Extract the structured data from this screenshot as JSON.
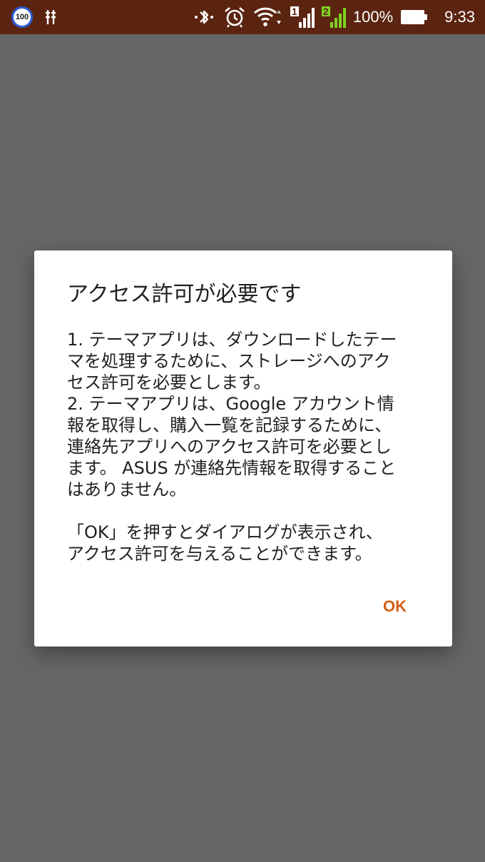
{
  "status_bar": {
    "badge": "100",
    "sim1": "1",
    "sim2": "2",
    "battery": "100%",
    "time": "9:33",
    "icons": [
      "bluetooth-icon",
      "alarm-icon",
      "wifi-icon",
      "signal-sim1-icon",
      "signal-sim2-icon",
      "battery-icon"
    ]
  },
  "dialog": {
    "title": "アクセス許可が必要です",
    "paragraph1": "1. テーマアプリは、ダウンロードしたテー\nマを処理するために、ストレージへのアク\nセス許可を必要とします。\n2. テーマアプリは、Google アカウント情\n報を取得し、購入一覧を記録するために、\n連絡先アプリへのアクセス許可を必要とし\nます。 ASUS が連絡先情報を取得すること\nはありません。",
    "paragraph2": "「OK」を押すとダイアログが表示され、\nアクセス許可を与えることができます。",
    "ok_label": "OK"
  },
  "colors": {
    "status_bar": "#5b2410",
    "scrim": "#666666",
    "accent": "#d55e13"
  }
}
